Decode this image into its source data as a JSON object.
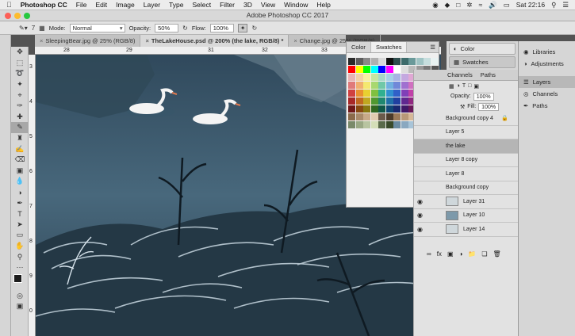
{
  "menubar": {
    "app": "Photoshop CC",
    "items": [
      "File",
      "Edit",
      "Image",
      "Layer",
      "Type",
      "Select",
      "Filter",
      "3D",
      "View",
      "Window",
      "Help"
    ],
    "clock": "Sat 22:16"
  },
  "window": {
    "title": "Adobe Photoshop CC 2017"
  },
  "options": {
    "brush_size": "7",
    "mode_label": "Mode:",
    "mode": "Normal",
    "opacity_label": "Opacity:",
    "opacity": "50%",
    "flow_label": "Flow:",
    "flow": "100%"
  },
  "tabs": [
    {
      "label": "SleepingBear.jpg @ 25% (RGB/8)"
    },
    {
      "label": "TheLakeHouse.psd @ 200% (the lake, RGB/8) *"
    },
    {
      "label": "Change.jpg @ 25% (RGB/8)"
    }
  ],
  "ruler": {
    "h": [
      "28",
      "29",
      "31",
      "32",
      "33"
    ],
    "v": [
      "3",
      "4",
      "5",
      "6",
      "7",
      "8",
      "9",
      "0"
    ]
  },
  "swatches_panel": {
    "tabs": [
      "Color",
      "Swatches"
    ],
    "colors": [
      "#2a2a2a",
      "#5c5c5c",
      "#888888",
      "#b0b0b0",
      "#d9d9d9",
      "#111111",
      "#2f4f4f",
      "#3d6b6b",
      "#6a9a9a",
      "#9fc4c4",
      "#c6dede",
      "#e8f2f2",
      "#ff0000",
      "#ffff00",
      "#00ff00",
      "#00ffff",
      "#0000ff",
      "#ff00ff",
      "#ffffff",
      "#dddddd",
      "#bbbbbb",
      "#999999",
      "#777777",
      "#555555",
      "#e8b4b4",
      "#f2d2a6",
      "#f7f1a1",
      "#c8e6a0",
      "#a6d8c8",
      "#a8d0e8",
      "#a8b4e4",
      "#c4a8e0",
      "#e0a8d4",
      "#f0a8c0",
      "#f4c8a8",
      "#f0e8b0",
      "#e07a7a",
      "#f0b070",
      "#f4e870",
      "#a8d870",
      "#70c8a8",
      "#70b0e0",
      "#7088d8",
      "#a070d0",
      "#d070c0",
      "#e870a0",
      "#e89870",
      "#d8d070",
      "#d04040",
      "#e89030",
      "#e8d030",
      "#80c040",
      "#30b090",
      "#3090d0",
      "#3060c8",
      "#8040b8",
      "#c040a8",
      "#d84078",
      "#c87040",
      "#b8b040",
      "#a82828",
      "#c06820",
      "#c0a820",
      "#509830",
      "#208870",
      "#2070a8",
      "#2040a0",
      "#602890",
      "#902880",
      "#a82858",
      "#985830",
      "#888828",
      "#701818",
      "#884810",
      "#887810",
      "#306820",
      "#105848",
      "#104878",
      "#182870",
      "#401868",
      "#681858",
      "#701838",
      "#684020",
      "#585818",
      "#8a6a4a",
      "#a88a6a",
      "#c8aa88",
      "#e0ccb0",
      "#6a5a4a",
      "#4a3a2a",
      "#9a7a5a",
      "#b89878",
      "#d6b898",
      "#705040",
      "#503828",
      "#302018",
      "#7a8a6a",
      "#9aa884",
      "#b8c4a0",
      "#d4deb8",
      "#5a6a4a",
      "#3a4a2a",
      "#6a8aa0",
      "#8aa8c0",
      "#a8c4d8",
      "#4a6a80",
      "#2a4a60",
      "#1a3040"
    ],
    "footer_icons": [
      "new-swatch-icon",
      "trash-icon"
    ]
  },
  "color_group": {
    "items": [
      "Color",
      "Swatches"
    ]
  },
  "layers_panel": {
    "tabs": [
      "Channels",
      "Paths"
    ],
    "opacity_label": "Opacity:",
    "opacity": "100%",
    "fill_label": "Fill:",
    "fill": "100%",
    "rows": [
      "Background copy 4",
      "Layer 5",
      "the lake",
      "Layer 8 copy",
      "Layer 8",
      "Background copy",
      "Layer 31",
      "Layer 10",
      "Layer 14"
    ]
  },
  "right_panel": {
    "items": [
      "Libraries",
      "Adjustments",
      "Layers",
      "Channels",
      "Paths"
    ]
  },
  "colors": {
    "menubar": "#ececec",
    "panel": "#d6d6d6",
    "canvas": "#3f5f73"
  }
}
